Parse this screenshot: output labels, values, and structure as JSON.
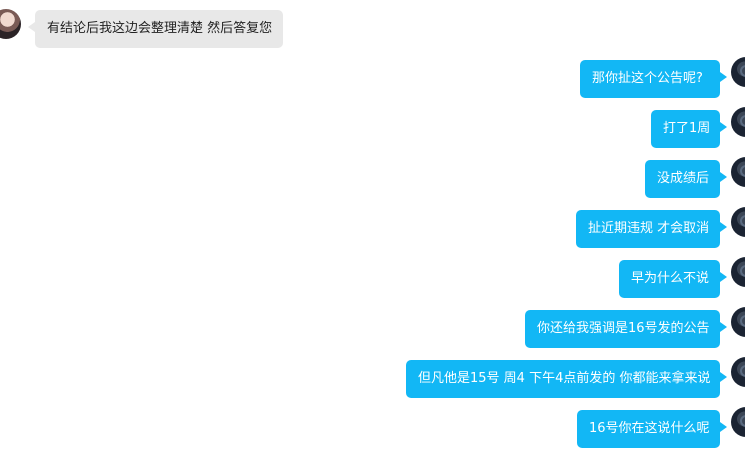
{
  "chat": {
    "incoming": [
      {
        "text": "有结论后我这边会整理清楚 然后答复您",
        "avatar": "sender-avatar"
      }
    ],
    "outgoing": [
      {
        "text": "那你扯这个公告呢?"
      },
      {
        "text": "打了1周"
      },
      {
        "text": "没成绩后"
      },
      {
        "text": "扯近期违规 才会取消"
      },
      {
        "text": "早为什么不说"
      },
      {
        "text": "你还给我强调是16号发的公告"
      },
      {
        "text": "但凡他是15号 周4 下午4点前发的 你都能来拿来说"
      },
      {
        "text": "16号你在这说什么呢"
      }
    ]
  },
  "colors": {
    "outgoing_bubble": "#12b7f5",
    "incoming_bubble": "#e8e8e8",
    "background": "#ffffff"
  }
}
